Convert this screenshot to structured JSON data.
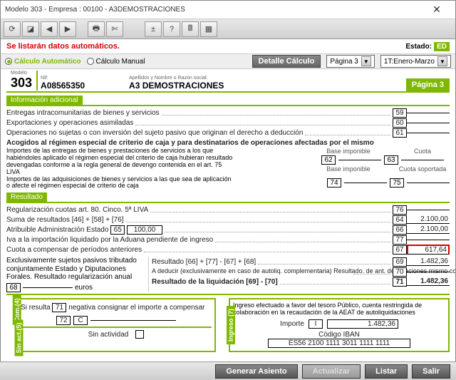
{
  "window": {
    "title": "Modelo 303 - Empresa : 00100 - A3DEMOSTRACIONES"
  },
  "status": {
    "warning": "Se listarán datos automáticos.",
    "estado_lbl": "Estado:",
    "estado_val": "ED"
  },
  "mode": {
    "auto": "Cálculo Automático",
    "manual": "Cálculo Manual",
    "detalle": "Detalle Cálculo",
    "pagina": "Página 3",
    "periodo": "1T:Enero-Marzo"
  },
  "header": {
    "modelo_lbl": "Modelo",
    "modelo": "303",
    "nif_lbl": "Nif:",
    "nif": "A08565350",
    "name_lbl": "Apellidos y Nombre o Razón social:",
    "name": "A3 DEMOSTRACIONES",
    "page_tab": "Página 3"
  },
  "sec_info": "Información adicional",
  "info": {
    "l1": {
      "txt": "Entregas intracomunitarias de bienes y servicios",
      "n": "59"
    },
    "l2": {
      "txt": "Exportaciones y operaciones asimiladas",
      "n": "60"
    },
    "l3": {
      "txt": "Operaciones no sujetas o con inversión del sujeto pasivo que originan el derecho a deducción",
      "n": "61"
    },
    "l4": {
      "txt": "Acogidos al régimen especial de criterio de caja y para destinatarios de operaciones afectadas por el mismo"
    },
    "col1": "Base imponible",
    "col2": "Cuota",
    "l5a": "Importes de las entregas de bienes y prestaciones de servicios a los que habiéndoles aplicado el régimen especial del criterio de caja hubieran resultado devengadas conforme a la regla general de devengo contenida en el art. 75 LIVA",
    "l5n1": "62",
    "l5n2": "63",
    "col3": "Base imponible",
    "col4": "Cuota soportada",
    "l6a": "Importes de las adquisiciones de bienes y servicios a las que sea de aplicación o afecte el régimen especial de criterio de caja",
    "l6n1": "74",
    "l6n2": "75"
  },
  "sec_res": "Resultado",
  "res": {
    "r1": {
      "txt": "Regularización cuotas art. 80. Cinco. 5ª LIVA",
      "n": "76"
    },
    "r2": {
      "txt": "Suma de resultados [46] + [58] + [76]",
      "n": "64",
      "v": "2.100,00"
    },
    "r3": {
      "txt": "Atribuible Administración Estado",
      "n": "65",
      "in": "100,00",
      "n2": "66",
      "v": "2.100,00"
    },
    "r4": {
      "txt": "Iva a la importación liquidado por la Aduana pendiente de ingreso",
      "n": "77"
    },
    "r5": {
      "txt": "Cuota a compensar de períodos anteriores",
      "n": "67",
      "v": "617,64"
    },
    "sub_l": "Exclusivamente sujetos pasivos tributado conjuntamente Estado y Diputaciones Forales. Resultado regularización anual",
    "sub_n": "68",
    "sub_u": "euros",
    "r6": {
      "txt": "Resultado [66] + [77] - [67] + [68]",
      "n": "69",
      "v": "1.482,36"
    },
    "r7": {
      "txt": "A deducir (exclusivamente en caso de autoliq. complementaria) Resultado. de ant. declaraciones mismo concepto, ejer. y per.",
      "n": "70"
    },
    "r8": {
      "txt": "Resultado de la liquidación [69] - [70]",
      "n": "71",
      "v": "1.482,36"
    }
  },
  "panels": {
    "com_lbl": "Com.(4)",
    "sin_lbl": "Sin\nact.(5)",
    "ing_lbl": "Ingreso (7)",
    "p1": {
      "l1a": "Si resulta",
      "l1n": "71",
      "l1b": "negativa consignar el importe a compensar",
      "l2n": "72",
      "l2c": "C",
      "l3": "Sin actividad"
    },
    "p2": {
      "txt": "Ingreso efectuado a favor del tesoro Público, cuenta restringida de colaboración en la recaudación de la AEAT de autoliquidaciones",
      "imp_lbl": "Importe",
      "imp_c": "I",
      "imp_v": "1.482,36",
      "iban_lbl": "Código IBAN",
      "iban": "ES56 2100 1111 3011 1111 1111"
    }
  },
  "footer": {
    "b1": "Generar Asiento",
    "b2": "Actualizar",
    "b3": "Listar",
    "b4": "Salir"
  },
  "chart_data": {
    "type": "table",
    "title": "Modelo 303 — Página 3 (Información adicional y Resultado)",
    "informacion_adicional": [
      {
        "casilla": 59,
        "concepto": "Entregas intracomunitarias de bienes y servicios",
        "valor": null
      },
      {
        "casilla": 60,
        "concepto": "Exportaciones y operaciones asimiladas",
        "valor": null
      },
      {
        "casilla": 61,
        "concepto": "Operaciones no sujetas o con inversión del sujeto pasivo que originan el derecho a deducción",
        "valor": null
      },
      {
        "casilla": 62,
        "concepto": "Criterio de caja — entregas (Base imponible)",
        "valor": null
      },
      {
        "casilla": 63,
        "concepto": "Criterio de caja — entregas (Cuota)",
        "valor": null
      },
      {
        "casilla": 74,
        "concepto": "Criterio de caja — adquisiciones (Base imponible)",
        "valor": null
      },
      {
        "casilla": 75,
        "concepto": "Criterio de caja — adquisiciones (Cuota soportada)",
        "valor": null
      }
    ],
    "resultado": [
      {
        "casilla": 76,
        "concepto": "Regularización cuotas art. 80. Cinco. 5ª LIVA",
        "valor": null
      },
      {
        "casilla": 64,
        "concepto": "Suma de resultados [46]+[58]+[76]",
        "valor": 2100.0
      },
      {
        "casilla": 65,
        "concepto": "Atribuible Administración Estado (%)",
        "valor": 100.0
      },
      {
        "casilla": 66,
        "concepto": "Atribuible Administración Estado (cuota)",
        "valor": 2100.0
      },
      {
        "casilla": 77,
        "concepto": "IVA importación liquidado por Aduana pendiente de ingreso",
        "valor": null
      },
      {
        "casilla": 67,
        "concepto": "Cuota a compensar de períodos anteriores",
        "valor": 617.64
      },
      {
        "casilla": 68,
        "concepto": "Regularización anual (Forales)",
        "valor": null
      },
      {
        "casilla": 69,
        "concepto": "Resultado [66]+[77]-[67]+[68]",
        "valor": 1482.36
      },
      {
        "casilla": 70,
        "concepto": "A deducir (complementaria)",
        "valor": null
      },
      {
        "casilla": 71,
        "concepto": "Resultado de la liquidación [69]-[70]",
        "valor": 1482.36
      }
    ],
    "ingreso": {
      "importe": 1482.36,
      "iban": "ES56 2100 1111 3011 1111 1111"
    }
  }
}
